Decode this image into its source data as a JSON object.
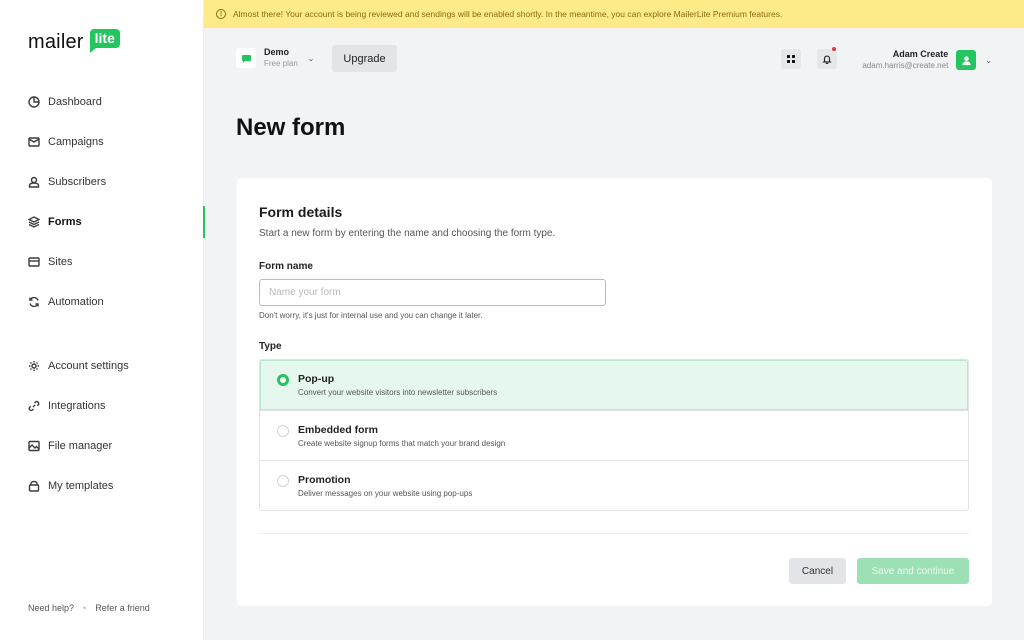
{
  "brand": {
    "name": "mailer",
    "badge": "lite",
    "accent": "#22c55e"
  },
  "banner": {
    "text": "Almost there! Your account is being reviewed and sendings will be enabled shortly. In the meantime, you can explore MailerLite Premium features."
  },
  "sidebar": {
    "items": [
      {
        "label": "Dashboard",
        "icon": "clock-icon",
        "active": false
      },
      {
        "label": "Campaigns",
        "icon": "envelope-icon",
        "active": false
      },
      {
        "label": "Subscribers",
        "icon": "user-icon",
        "active": false
      },
      {
        "label": "Forms",
        "icon": "layers-icon",
        "active": true
      },
      {
        "label": "Sites",
        "icon": "browser-icon",
        "active": false
      },
      {
        "label": "Automation",
        "icon": "refresh-icon",
        "active": false
      }
    ],
    "secondary_items": [
      {
        "label": "Account settings",
        "icon": "gear-icon"
      },
      {
        "label": "Integrations",
        "icon": "link-icon"
      },
      {
        "label": "File manager",
        "icon": "image-icon"
      },
      {
        "label": "My templates",
        "icon": "bag-icon"
      }
    ],
    "footer": {
      "help": "Need help?",
      "separator": "•",
      "refer": "Refer a friend"
    }
  },
  "topbar": {
    "account_name": "Demo",
    "account_plan": "Free plan",
    "upgrade_label": "Upgrade",
    "user_name": "Adam Create",
    "user_email": "adam.harris@create.net",
    "has_notification": true
  },
  "page": {
    "title": "New form"
  },
  "form": {
    "section_title": "Form details",
    "section_subtitle": "Start a new form by entering the name and choosing the form type.",
    "name_label": "Form name",
    "name_value": "",
    "name_placeholder": "Name your form",
    "name_hint": "Don't worry, it's just for internal use and you can change it later.",
    "type_label": "Type",
    "types": [
      {
        "title": "Pop-up",
        "description": "Convert your website visitors into newsletter subscribers",
        "selected": true
      },
      {
        "title": "Embedded form",
        "description": "Create website signup forms that match your brand design",
        "selected": false
      },
      {
        "title": "Promotion",
        "description": "Deliver messages on your website using pop-ups",
        "selected": false
      }
    ],
    "cancel_label": "Cancel",
    "save_label": "Save and continue"
  }
}
